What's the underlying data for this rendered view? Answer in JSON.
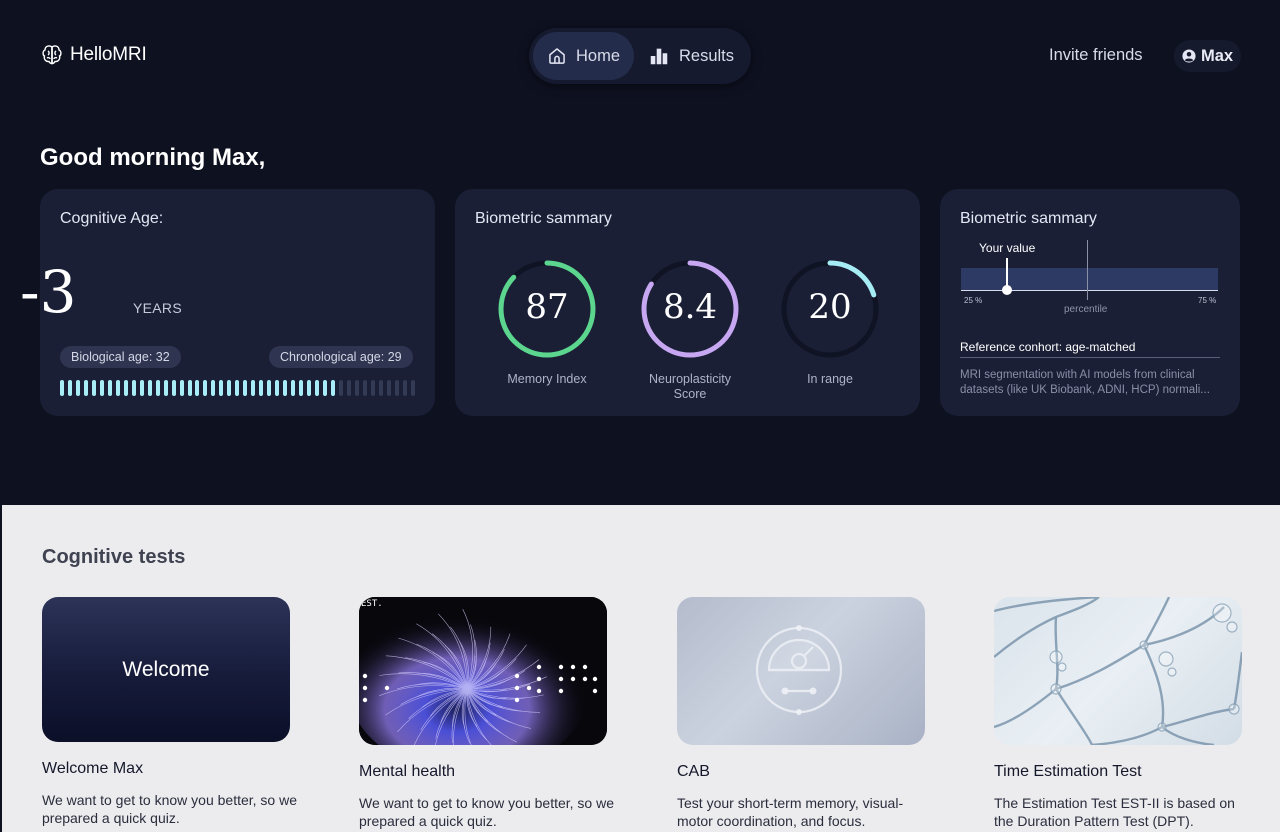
{
  "brand": {
    "name": "HelloMRI"
  },
  "nav": {
    "home": "Home",
    "results": "Results"
  },
  "header": {
    "invite": "Invite friends",
    "user": "Max"
  },
  "greeting": "Good morning Max,",
  "cognitive_age": {
    "title": "Cognitive Age:",
    "value": "-3",
    "unit": "YEARS",
    "biological": "Biological age: 32",
    "chronological": "Chronological age: 29",
    "filled_fraction": 0.77
  },
  "biometric_summary": {
    "title": "Biometric sammary",
    "gauges": [
      {
        "value": "87",
        "label": "Memory Index",
        "fraction": 0.87,
        "color": "#5cd68e"
      },
      {
        "value": "8.4",
        "label": "Neuroplasticity Score",
        "fraction": 0.84,
        "color": "#c8a7f2"
      },
      {
        "value": "20",
        "label": "In range",
        "fraction": 0.2,
        "color": "#a6ecf5"
      }
    ]
  },
  "percentile_card": {
    "title": "Biometric sammary",
    "your_value": "Your value",
    "tick_low": "25 %",
    "tick_high": "75 %",
    "axis_label": "percentile",
    "reference": "Reference conhort: age-matched",
    "description": "MRI segmentation with AI models from clinical datasets (like UK Biobank, ADNI, HCP) normali..."
  },
  "tests": {
    "title": "Cognitive tests",
    "items": [
      {
        "image_label": "Welcome",
        "title": "Welcome Max",
        "desc": "We want to get to know you better, so we prepared a quick quiz."
      },
      {
        "image_label": "EST.",
        "title": "Mental health",
        "desc": "We want to get to know you better, so we prepared a quick quiz."
      },
      {
        "title": "CAB",
        "desc": "Test your short-term memory, visual-motor coordination, and focus."
      },
      {
        "title": "Time Estimation Test",
        "desc": "The Estimation Test EST-II is based on the Duration Pattern Test (DPT)."
      }
    ]
  },
  "colors": {
    "background": "#0e1120",
    "card": "#1a1f36",
    "nav_active": "#242c4b",
    "lower_bg": "#ececef"
  },
  "icons": {
    "logo": "brain-icon",
    "home": "home-icon",
    "results": "bar-chart-icon",
    "user": "user-circle-icon"
  }
}
